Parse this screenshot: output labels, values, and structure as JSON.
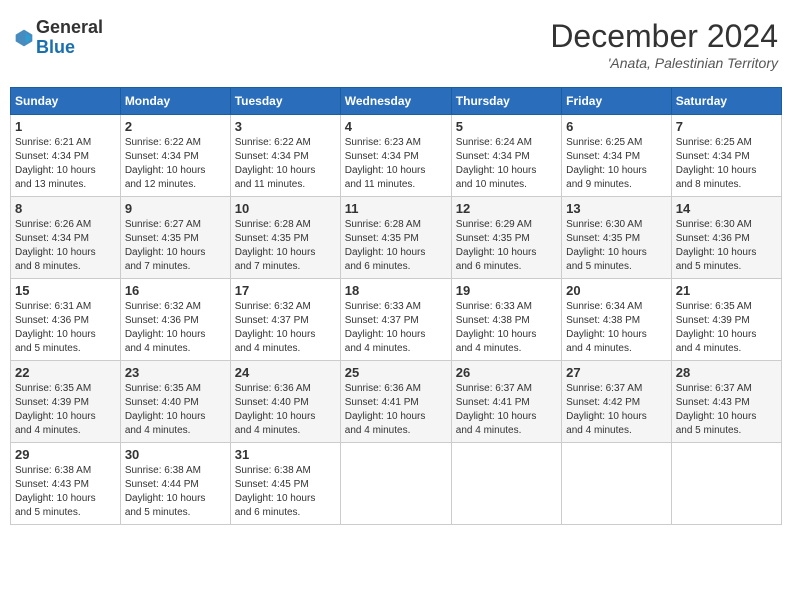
{
  "header": {
    "logo_general": "General",
    "logo_blue": "Blue",
    "month_title": "December 2024",
    "location": "'Anata, Palestinian Territory"
  },
  "weekdays": [
    "Sunday",
    "Monday",
    "Tuesday",
    "Wednesday",
    "Thursday",
    "Friday",
    "Saturday"
  ],
  "weeks": [
    [
      {
        "day": "1",
        "info": "Sunrise: 6:21 AM\nSunset: 4:34 PM\nDaylight: 10 hours\nand 13 minutes."
      },
      {
        "day": "2",
        "info": "Sunrise: 6:22 AM\nSunset: 4:34 PM\nDaylight: 10 hours\nand 12 minutes."
      },
      {
        "day": "3",
        "info": "Sunrise: 6:22 AM\nSunset: 4:34 PM\nDaylight: 10 hours\nand 11 minutes."
      },
      {
        "day": "4",
        "info": "Sunrise: 6:23 AM\nSunset: 4:34 PM\nDaylight: 10 hours\nand 11 minutes."
      },
      {
        "day": "5",
        "info": "Sunrise: 6:24 AM\nSunset: 4:34 PM\nDaylight: 10 hours\nand 10 minutes."
      },
      {
        "day": "6",
        "info": "Sunrise: 6:25 AM\nSunset: 4:34 PM\nDaylight: 10 hours\nand 9 minutes."
      },
      {
        "day": "7",
        "info": "Sunrise: 6:25 AM\nSunset: 4:34 PM\nDaylight: 10 hours\nand 8 minutes."
      }
    ],
    [
      {
        "day": "8",
        "info": "Sunrise: 6:26 AM\nSunset: 4:34 PM\nDaylight: 10 hours\nand 8 minutes."
      },
      {
        "day": "9",
        "info": "Sunrise: 6:27 AM\nSunset: 4:35 PM\nDaylight: 10 hours\nand 7 minutes."
      },
      {
        "day": "10",
        "info": "Sunrise: 6:28 AM\nSunset: 4:35 PM\nDaylight: 10 hours\nand 7 minutes."
      },
      {
        "day": "11",
        "info": "Sunrise: 6:28 AM\nSunset: 4:35 PM\nDaylight: 10 hours\nand 6 minutes."
      },
      {
        "day": "12",
        "info": "Sunrise: 6:29 AM\nSunset: 4:35 PM\nDaylight: 10 hours\nand 6 minutes."
      },
      {
        "day": "13",
        "info": "Sunrise: 6:30 AM\nSunset: 4:35 PM\nDaylight: 10 hours\nand 5 minutes."
      },
      {
        "day": "14",
        "info": "Sunrise: 6:30 AM\nSunset: 4:36 PM\nDaylight: 10 hours\nand 5 minutes."
      }
    ],
    [
      {
        "day": "15",
        "info": "Sunrise: 6:31 AM\nSunset: 4:36 PM\nDaylight: 10 hours\nand 5 minutes."
      },
      {
        "day": "16",
        "info": "Sunrise: 6:32 AM\nSunset: 4:36 PM\nDaylight: 10 hours\nand 4 minutes."
      },
      {
        "day": "17",
        "info": "Sunrise: 6:32 AM\nSunset: 4:37 PM\nDaylight: 10 hours\nand 4 minutes."
      },
      {
        "day": "18",
        "info": "Sunrise: 6:33 AM\nSunset: 4:37 PM\nDaylight: 10 hours\nand 4 minutes."
      },
      {
        "day": "19",
        "info": "Sunrise: 6:33 AM\nSunset: 4:38 PM\nDaylight: 10 hours\nand 4 minutes."
      },
      {
        "day": "20",
        "info": "Sunrise: 6:34 AM\nSunset: 4:38 PM\nDaylight: 10 hours\nand 4 minutes."
      },
      {
        "day": "21",
        "info": "Sunrise: 6:35 AM\nSunset: 4:39 PM\nDaylight: 10 hours\nand 4 minutes."
      }
    ],
    [
      {
        "day": "22",
        "info": "Sunrise: 6:35 AM\nSunset: 4:39 PM\nDaylight: 10 hours\nand 4 minutes."
      },
      {
        "day": "23",
        "info": "Sunrise: 6:35 AM\nSunset: 4:40 PM\nDaylight: 10 hours\nand 4 minutes."
      },
      {
        "day": "24",
        "info": "Sunrise: 6:36 AM\nSunset: 4:40 PM\nDaylight: 10 hours\nand 4 minutes."
      },
      {
        "day": "25",
        "info": "Sunrise: 6:36 AM\nSunset: 4:41 PM\nDaylight: 10 hours\nand 4 minutes."
      },
      {
        "day": "26",
        "info": "Sunrise: 6:37 AM\nSunset: 4:41 PM\nDaylight: 10 hours\nand 4 minutes."
      },
      {
        "day": "27",
        "info": "Sunrise: 6:37 AM\nSunset: 4:42 PM\nDaylight: 10 hours\nand 4 minutes."
      },
      {
        "day": "28",
        "info": "Sunrise: 6:37 AM\nSunset: 4:43 PM\nDaylight: 10 hours\nand 5 minutes."
      }
    ],
    [
      {
        "day": "29",
        "info": "Sunrise: 6:38 AM\nSunset: 4:43 PM\nDaylight: 10 hours\nand 5 minutes."
      },
      {
        "day": "30",
        "info": "Sunrise: 6:38 AM\nSunset: 4:44 PM\nDaylight: 10 hours\nand 5 minutes."
      },
      {
        "day": "31",
        "info": "Sunrise: 6:38 AM\nSunset: 4:45 PM\nDaylight: 10 hours\nand 6 minutes."
      },
      null,
      null,
      null,
      null
    ]
  ]
}
